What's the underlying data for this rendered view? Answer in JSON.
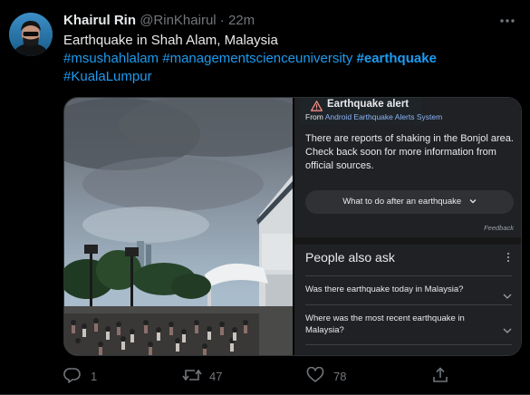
{
  "tweet": {
    "display_name": "Khairul Rin",
    "handle": "@RinKhairul",
    "separator": "·",
    "time": "22m",
    "text_line": "Earthquake in Shah Alam, Malaysia",
    "hashtags": [
      "#msushahlalam",
      "#managementscienceuniversity",
      "#earthquake",
      "#KualaLumpur"
    ]
  },
  "alert_panel": {
    "title": "Earthquake alert",
    "source_prefix": "From",
    "source_link": "Android Earthquake Alerts System",
    "body": "There are reports of shaking in the Bonjol area. Check back soon for more information from official sources.",
    "button_label": "What to do after an earthquake",
    "feedback": "Feedback",
    "paa_title": "People also ask",
    "questions": [
      "Was there earthquake today in Malaysia?",
      "Where was the most recent earthquake in Malaysia?"
    ]
  },
  "actions": {
    "replies": "1",
    "retweets": "47",
    "likes": "78"
  },
  "colors": {
    "background": "#000000",
    "link": "#1d9bf0",
    "muted": "#71767b",
    "panel": "#202124"
  },
  "icons": {
    "more": "more-icon",
    "reply": "reply-icon",
    "retweet": "retweet-icon",
    "like": "heart-icon",
    "share": "share-icon",
    "warning": "warning-icon"
  }
}
